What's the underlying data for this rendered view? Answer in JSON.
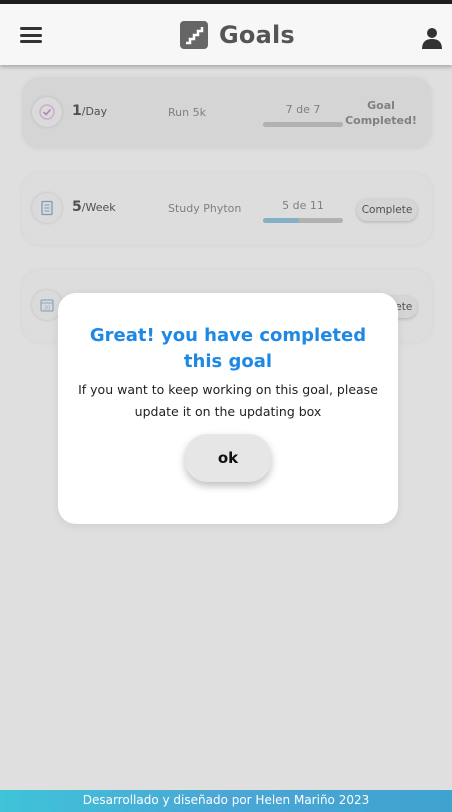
{
  "header": {
    "title": "Goals",
    "menu_icon": "hamburger-menu-icon",
    "brand_icon": "stairs-icon",
    "user_icon": "user-icon"
  },
  "goals": [
    {
      "count": "1",
      "period": "/Day",
      "name": "Run 5k",
      "progress_label": "7 de 7",
      "progress": 1.0,
      "status": "Goal Completed!",
      "icon": "check-circle-icon"
    },
    {
      "count": "5",
      "period": "/Week",
      "name": "Study Phyton",
      "progress_label": "5 de 11",
      "progress": 0.4545,
      "action": "Complete",
      "icon": "book-icon"
    },
    {
      "action": "Complete",
      "icon": "calendar-icon"
    }
  ],
  "modal": {
    "title": "Great! you have completed this goal",
    "message": "If you want to keep working on this goal, please update it on the updating box",
    "ok_label": "ok"
  },
  "footer": {
    "text": "Desarrollado y diseñado por Helen Mariño 2023"
  },
  "colors": {
    "accent": "#1e88e5",
    "progress": "#8cbcd0",
    "footer_start": "#3fc4d8",
    "footer_end": "#3fa3cf"
  }
}
